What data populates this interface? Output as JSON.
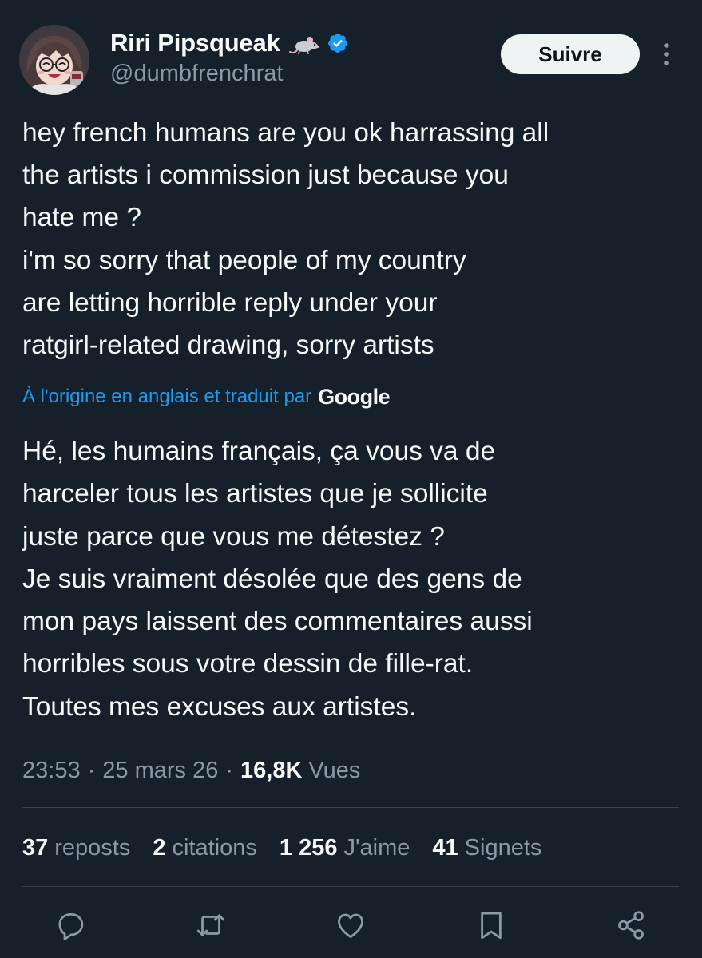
{
  "author": {
    "display_name": "Riri Pipsqueak",
    "handle": "@dumbfrenchrat",
    "verified": true,
    "name_emoji": "rat-emoji",
    "avatar": "anime-girl-avatar"
  },
  "header": {
    "follow_label": "Suivre",
    "more_icon": "more-vertical-icon"
  },
  "tweet": {
    "text": "hey french humans are you ok harrassing all\nthe artists i commission just because you\nhate me ?\ni'm so sorry that people of my country\nare letting horrible reply under your\nratgirl-related drawing, sorry artists",
    "translation_label": "À l'origine en anglais et traduit par",
    "translation_provider": "Google",
    "translated_text": "Hé, les humains français, ça vous va de\nharceler tous les artistes que je sollicite\njuste parce que vous me détestez ?\nJe suis vraiment désolée que des gens de\nmon pays laissent des commentaires aussi\nhorribles sous votre dessin de fille-rat.\nToutes mes excuses aux artistes."
  },
  "meta": {
    "time": "23:53",
    "separator": "·",
    "date": "25 mars 26",
    "views_count": "16,8K",
    "views_label": "Vues"
  },
  "stats": [
    {
      "count": "37",
      "label": "reposts"
    },
    {
      "count": "2",
      "label": "citations"
    },
    {
      "count": "1 256",
      "label": "J'aime"
    },
    {
      "count": "41",
      "label": "Signets"
    }
  ],
  "actions": [
    "reply-icon",
    "repost-icon",
    "like-icon",
    "bookmark-icon",
    "share-icon"
  ],
  "colors": {
    "background": "#15202b",
    "text_primary": "#f7f9f9",
    "text_secondary": "#8b98a5",
    "accent": "#1d9bf0",
    "divider": "#38444d",
    "follow_button_bg": "#eff3f4"
  }
}
